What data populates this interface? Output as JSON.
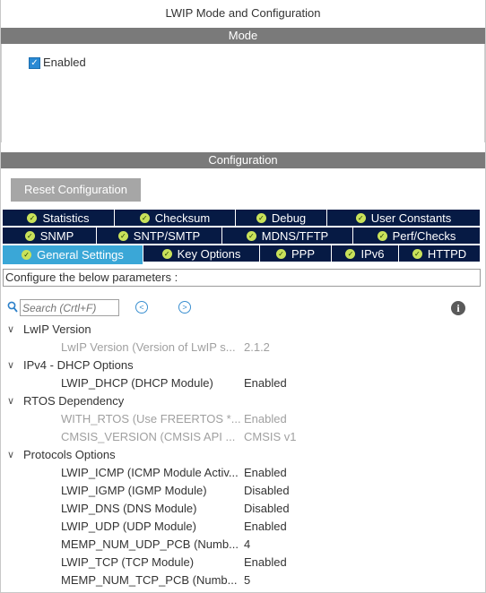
{
  "window": {
    "title": "LWIP Mode and Configuration"
  },
  "mode": {
    "header": "Mode",
    "enabled_label": "Enabled",
    "enabled_checked": true
  },
  "configuration": {
    "header": "Configuration",
    "reset_label": "Reset Configuration",
    "tabs_row1": [
      "Statistics",
      "Checksum",
      "Debug",
      "User Constants"
    ],
    "tabs_row2": [
      "SNMP",
      "SNTP/SMTP",
      "MDNS/TFTP",
      "Perf/Checks"
    ],
    "tabs_row3": [
      "General Settings",
      "Key Options",
      "PPP",
      "IPv6",
      "HTTPD"
    ],
    "active_tab": "General Settings",
    "configure_text": "Configure the below parameters :",
    "search_placeholder": "Search (Crtl+F)"
  },
  "tree": [
    {
      "type": "group",
      "label": "LwIP Version"
    },
    {
      "type": "param",
      "name": "LwIP Version (Version of LwIP s...",
      "value": "2.1.2",
      "disabled": true
    },
    {
      "type": "group",
      "label": "IPv4 - DHCP Options"
    },
    {
      "type": "param",
      "name": "LWIP_DHCP (DHCP Module)",
      "value": "Enabled",
      "disabled": false
    },
    {
      "type": "group",
      "label": "RTOS Dependency"
    },
    {
      "type": "param",
      "name": "WITH_RTOS (Use FREERTOS *...",
      "value": "Enabled",
      "disabled": true
    },
    {
      "type": "param",
      "name": "CMSIS_VERSION (CMSIS API ...",
      "value": "CMSIS v1",
      "disabled": true
    },
    {
      "type": "group",
      "label": "Protocols Options"
    },
    {
      "type": "param",
      "name": "LWIP_ICMP (ICMP Module Activ...",
      "value": "Enabled",
      "disabled": false
    },
    {
      "type": "param",
      "name": "LWIP_IGMP (IGMP Module)",
      "value": "Disabled",
      "disabled": false
    },
    {
      "type": "param",
      "name": "LWIP_DNS (DNS Module)",
      "value": "Disabled",
      "disabled": false
    },
    {
      "type": "param",
      "name": "LWIP_UDP (UDP Module)",
      "value": "Enabled",
      "disabled": false
    },
    {
      "type": "param",
      "name": "MEMP_NUM_UDP_PCB (Numb...",
      "value": "4",
      "disabled": false
    },
    {
      "type": "param",
      "name": "LWIP_TCP (TCP Module)",
      "value": "Enabled",
      "disabled": false
    },
    {
      "type": "param",
      "name": "MEMP_NUM_TCP_PCB (Numb...",
      "value": "5",
      "disabled": false
    }
  ],
  "colors": {
    "tab_bg": "#061a44",
    "tab_active_bg": "#3aa7d7",
    "section_bar": "#7a7a7a",
    "checkbox": "#2a8ad4",
    "status_dot": "#c9e25a"
  }
}
